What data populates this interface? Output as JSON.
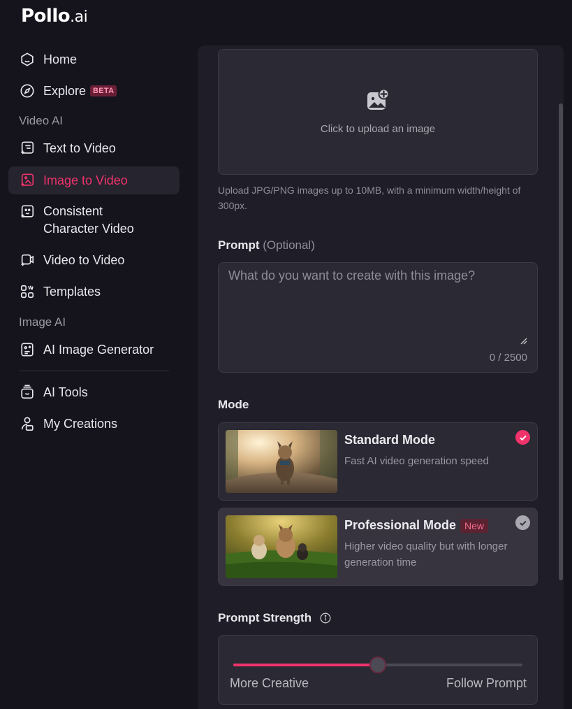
{
  "app": {
    "logo_main": "Pollo",
    "logo_tld": ".ai"
  },
  "sidebar": {
    "items": [
      {
        "label": "Home",
        "icon": "home-icon"
      },
      {
        "label": "Explore",
        "icon": "compass-icon",
        "badge": "BETA"
      },
      {
        "label": "Text to Video",
        "icon": "text-to-video-icon"
      },
      {
        "label": "Image to Video",
        "icon": "image-to-video-icon",
        "active": true
      },
      {
        "label": "Consistent\nCharacter Video",
        "icon": "character-video-icon"
      },
      {
        "label": "Video to Video",
        "icon": "video-to-video-icon"
      },
      {
        "label": "Templates",
        "icon": "templates-icon"
      },
      {
        "label": "AI Image Generator",
        "icon": "image-generator-icon"
      },
      {
        "label": "AI Tools",
        "icon": "ai-tools-icon"
      },
      {
        "label": "My Creations",
        "icon": "user-folder-icon"
      }
    ],
    "sections": {
      "video_ai": "Video AI",
      "image_ai": "Image AI"
    }
  },
  "upload": {
    "label": "Click to upload an image",
    "hint": "Upload JPG/PNG images up to 10MB, with a minimum width/height of 300px.",
    "icon": "image-add-icon"
  },
  "prompt": {
    "label": "Prompt",
    "optional": "(Optional)",
    "placeholder": "What do you want to create with this image?",
    "value": "",
    "counter": "0 / 2500"
  },
  "mode": {
    "label": "Mode",
    "options": [
      {
        "title": "Standard Mode",
        "desc": "Fast AI video generation speed",
        "selected": true
      },
      {
        "title": "Professional Mode",
        "badge": "New",
        "desc": "Higher video quality but with longer generation time",
        "selected": false
      }
    ]
  },
  "strength": {
    "label": "Prompt Strength",
    "left_label": "More Creative",
    "right_label": "Follow Prompt",
    "value": 0.5
  },
  "colors": {
    "accent": "#f0336b",
    "bg": "#15141c",
    "panel": "#1f1e28"
  }
}
